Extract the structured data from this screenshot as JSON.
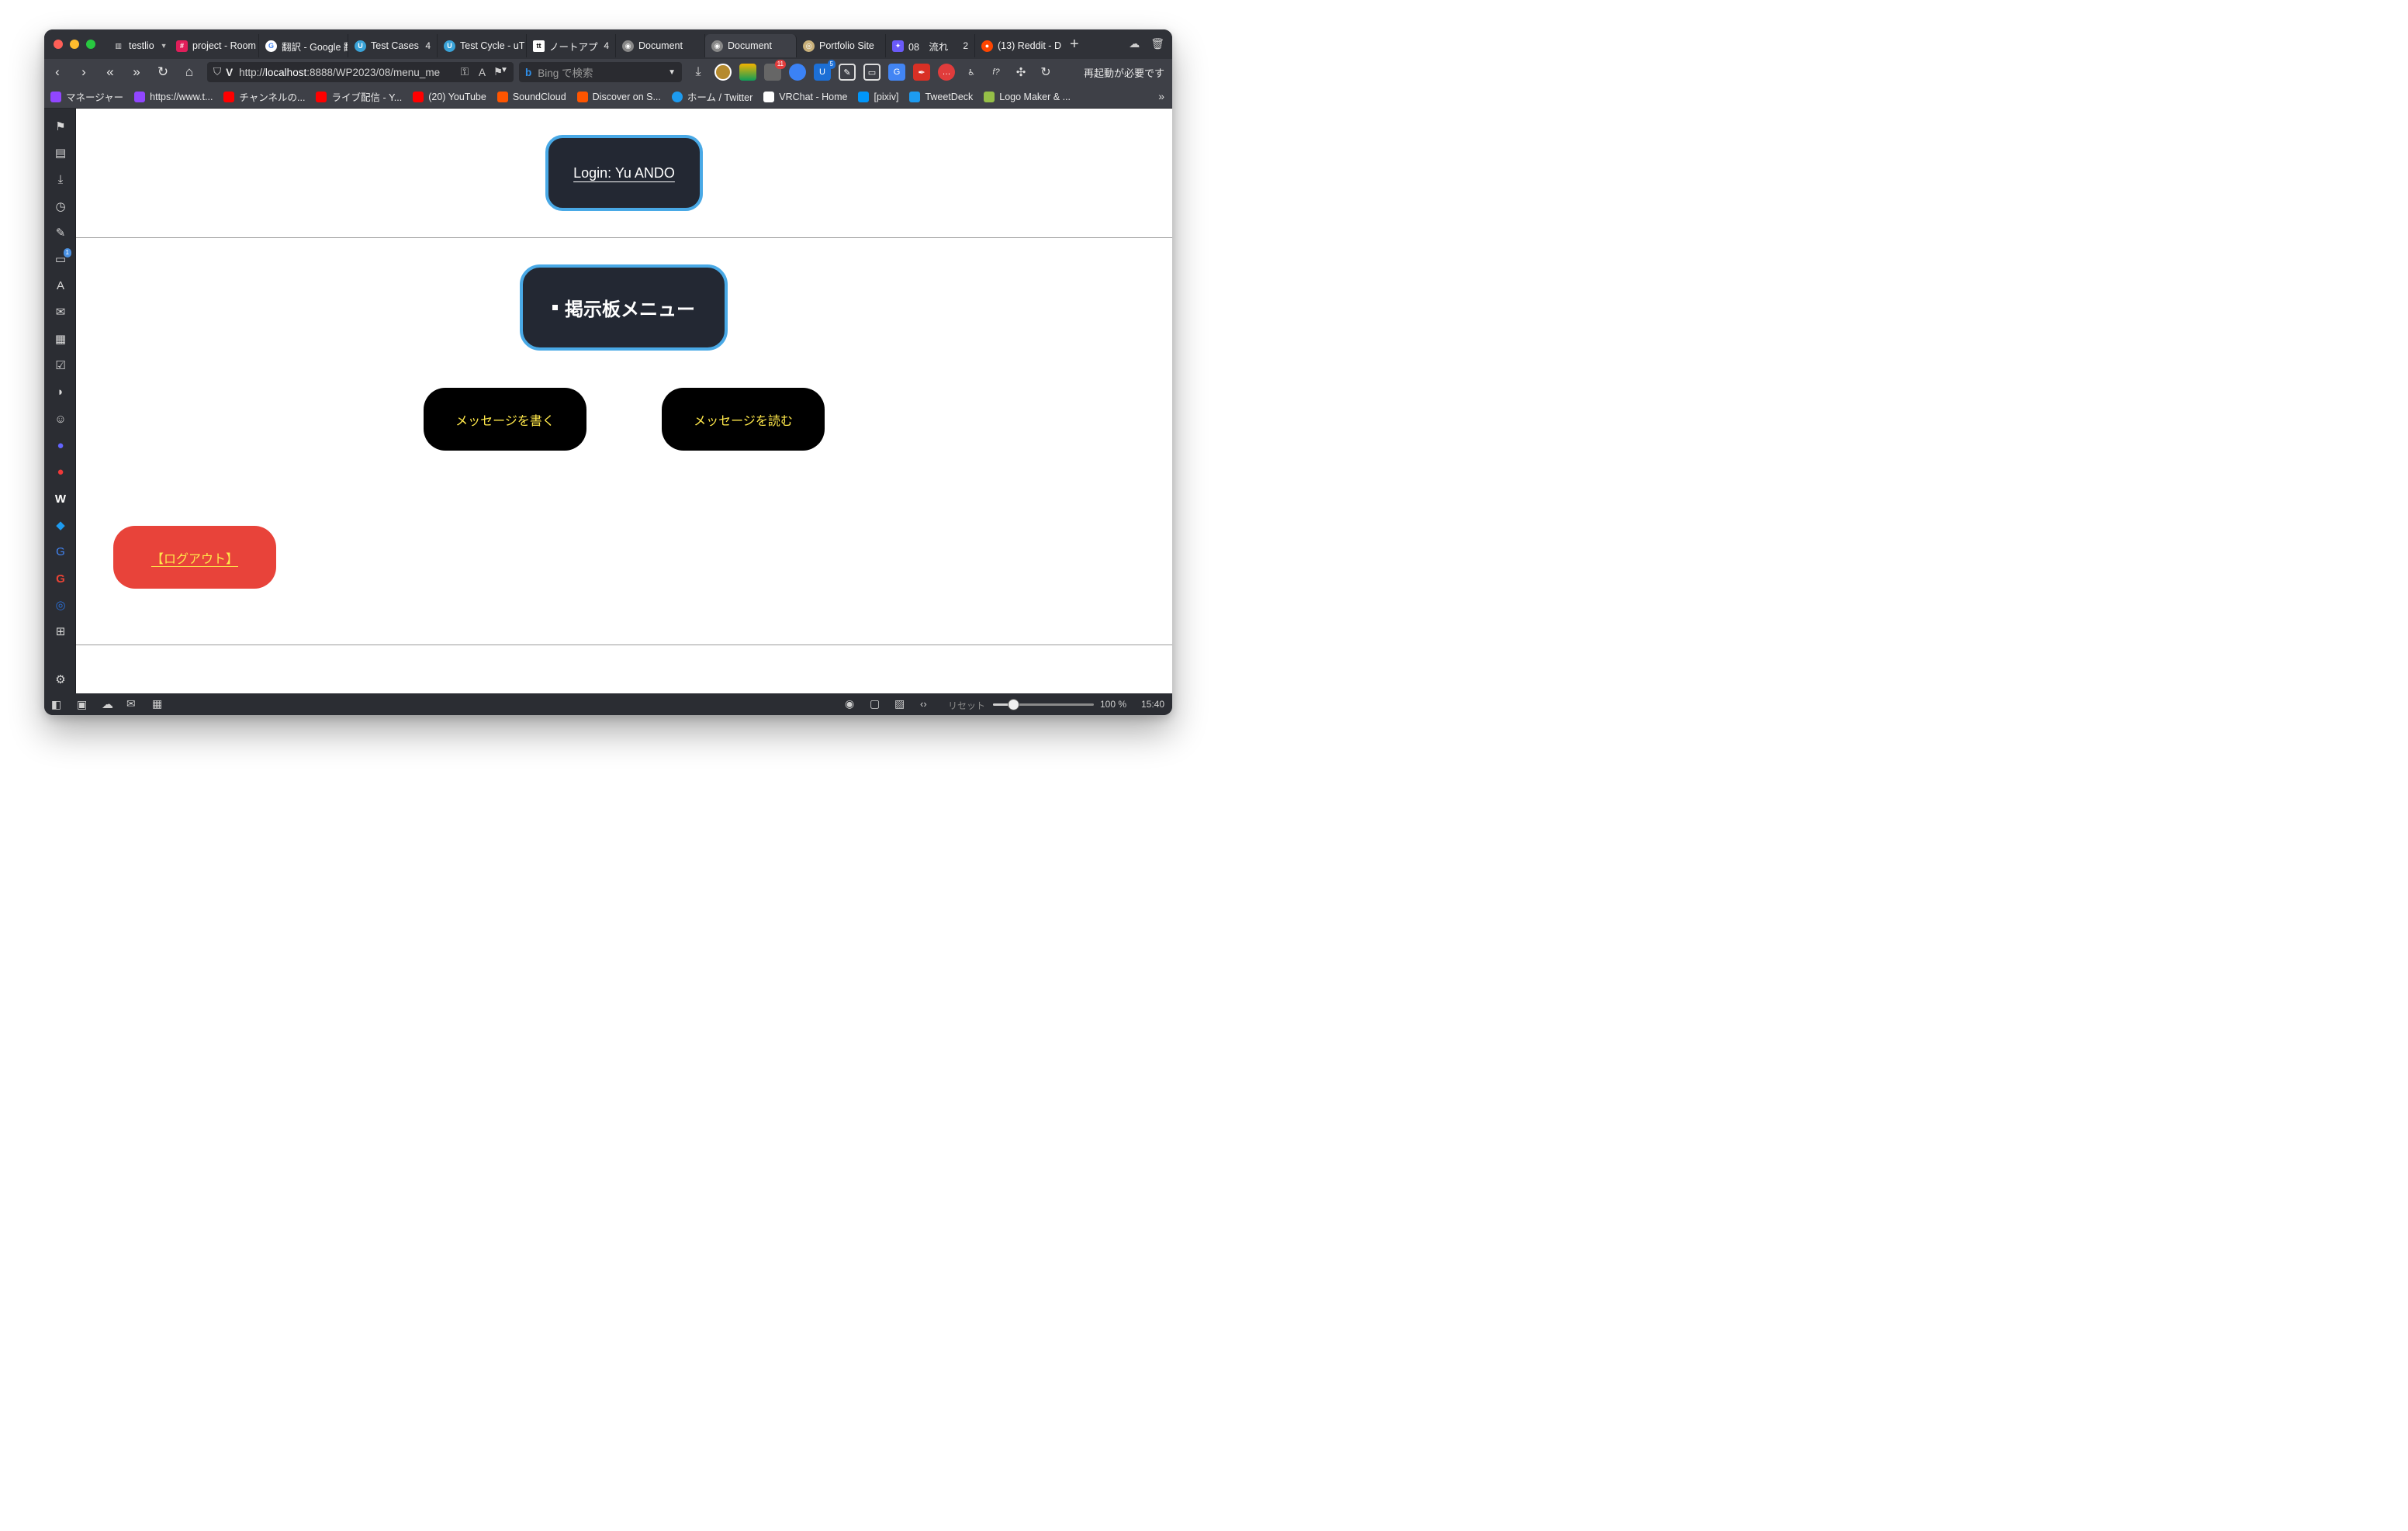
{
  "browser": {
    "tabs": [
      {
        "label": "testlio",
        "count": ""
      },
      {
        "label": "project - Room",
        "count": ""
      },
      {
        "label": "翻訳 - Google 翻",
        "count": ""
      },
      {
        "label": "Test Cases",
        "count": "4"
      },
      {
        "label": "Test Cycle - uT",
        "count": ""
      },
      {
        "label": "ノートアプ",
        "count": "4"
      },
      {
        "label": "Document",
        "count": ""
      },
      {
        "label": "Document",
        "count": ""
      },
      {
        "label": "Portfolio Site",
        "count": ""
      },
      {
        "label": "08　流れ",
        "count": "2"
      },
      {
        "label": "(13) Reddit - D",
        "count": ""
      }
    ],
    "url_prefix": "http://",
    "url_host": "localhost",
    "url_rest": ":8888/WP2023/08/menu_me",
    "search_placeholder": "Bing で検索",
    "restart_label": "再起動が必要です",
    "ext_badges": {
      "notify": "11",
      "ublock": "5"
    },
    "side_badge": "1",
    "bookmarks": [
      "マネージャー",
      "https://www.t...",
      "チャンネルの...",
      "ライブ配信 - Y...",
      "(20) YouTube",
      "SoundCloud",
      "Discover on S...",
      "ホーム / Twitter",
      "VRChat - Home",
      "[pixiv]",
      "TweetDeck",
      "Logo Maker & ..."
    ],
    "status": {
      "reset_label": "リセット",
      "zoom_level": "100 %",
      "zoom_fraction": 0.2,
      "time": "15:40"
    }
  },
  "page": {
    "login_text": "Login: Yu ANDO",
    "menu_title": "掲示板メニュー",
    "write_button": "メッセージを書く",
    "read_button": "メッセージを読む",
    "logout_link": "【ログアウト】"
  },
  "colors": {
    "accent_border": "#49a9e6",
    "box_dark": "#232833",
    "button_text": "#ffe84a",
    "logout_bg": "#e8433a"
  }
}
